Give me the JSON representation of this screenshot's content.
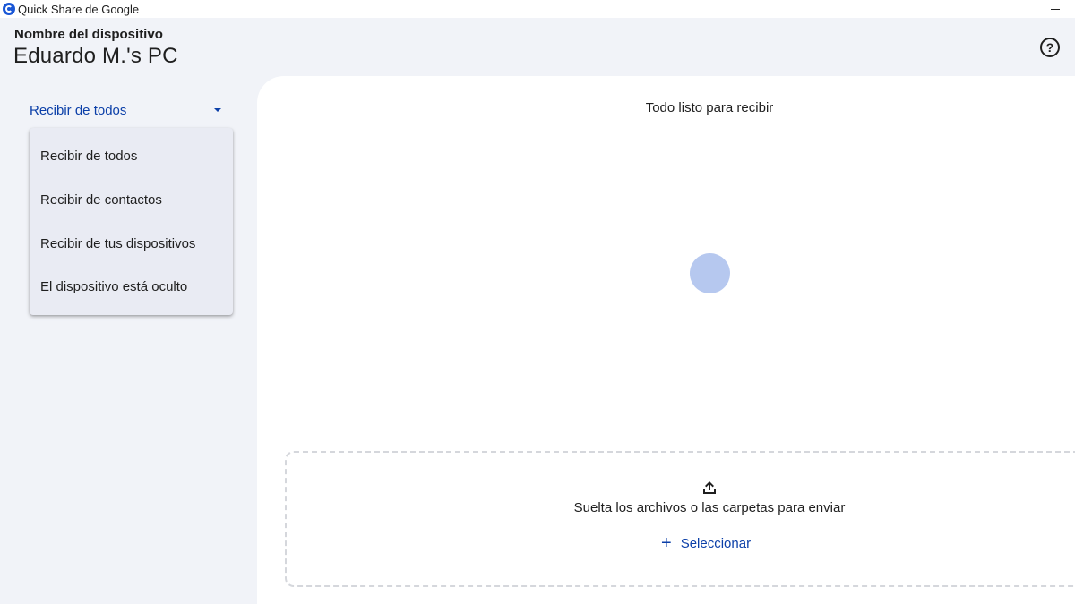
{
  "window": {
    "title": "Quick Share de Google",
    "logo_icon": "quick-share-icon",
    "minimize_icon": "minimize-icon"
  },
  "header": {
    "device_label": "Nombre del dispositivo",
    "device_name": "Eduardo M.'s PC",
    "help_symbol": "?"
  },
  "sidebar": {
    "visibility_selected": "Recibir de todos",
    "menu_options": [
      "Recibir de todos",
      "Recibir de contactos",
      "Recibir de tus dispositivos",
      "El dispositivo está oculto"
    ]
  },
  "main": {
    "status": "Todo listo para recibir",
    "drop_text": "Suelta los archivos o las carpetas para enviar",
    "select_label": "Seleccionar",
    "select_symbol": "+"
  },
  "colors": {
    "accent": "#0b3fa8",
    "background": "#f1f3f8",
    "panel": "#ffffff",
    "menu_bg": "#e9ebf3",
    "pulse": "#b6c8ef"
  }
}
